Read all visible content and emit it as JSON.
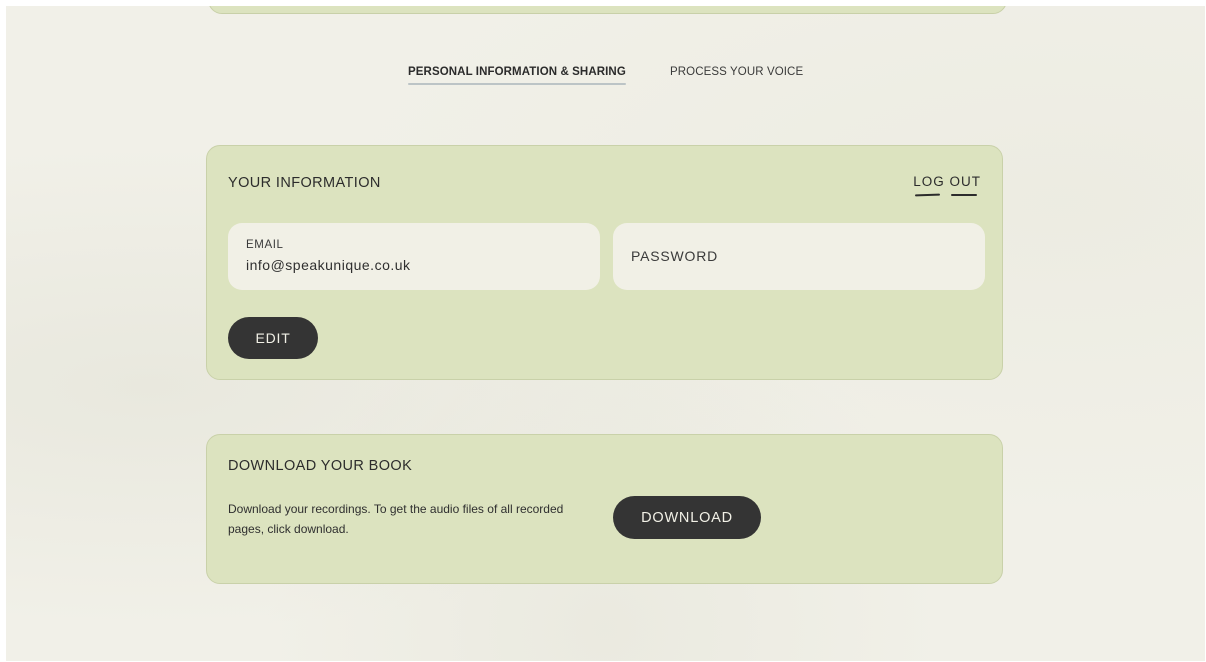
{
  "tabs": [
    {
      "label": "PERSONAL INFORMATION & SHARING",
      "active": true
    },
    {
      "label": "PROCESS YOUR VOICE",
      "active": false
    }
  ],
  "info_card": {
    "title": "YOUR INFORMATION",
    "logout_label": "LOG OUT",
    "email": {
      "label": "EMAIL",
      "value": "info@speakunique.co.uk"
    },
    "password": {
      "label": "PASSWORD"
    },
    "edit_label": "EDIT"
  },
  "download_card": {
    "title": "DOWNLOAD YOUR BOOK",
    "description": "Download your recordings. To get the audio files of all recorded pages, click download.",
    "download_label": "DOWNLOAD"
  },
  "colors": {
    "background": "#f1f0e8",
    "card": "#dce3bf",
    "field": "#f1f0e6",
    "button": "#343434",
    "button_text": "#f1f0e6"
  }
}
